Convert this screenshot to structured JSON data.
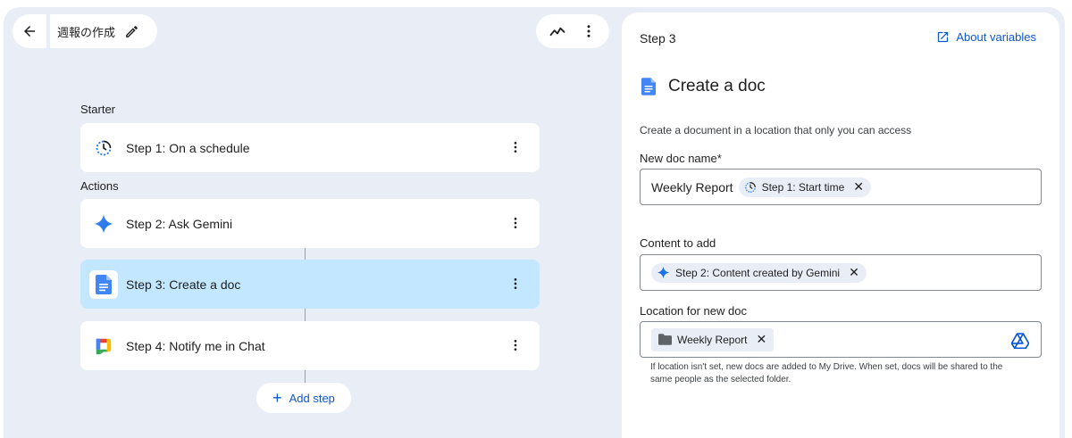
{
  "header": {
    "title": "週報の作成"
  },
  "flow": {
    "starter_label": "Starter",
    "actions_label": "Actions",
    "steps": [
      {
        "prefix": "Step 1:",
        "name": "On a schedule",
        "icon": "schedule-icon"
      },
      {
        "prefix": "Step 2:",
        "name": "Ask Gemini",
        "icon": "gemini-sparkle-icon"
      },
      {
        "prefix": "Step 3:",
        "name": "Create a doc",
        "icon": "google-docs-icon",
        "selected": true
      },
      {
        "prefix": "Step 4:",
        "name": "Notify me in Chat",
        "icon": "google-chat-icon"
      }
    ],
    "add_step_label": "Add step"
  },
  "panel": {
    "step_label": "Step 3",
    "about_label": "About variables",
    "title": "Create a doc",
    "description": "Create a document in a location that only you can access",
    "doc_name": {
      "label": "New doc name*",
      "text": "Weekly Report",
      "chip": "Step 1: Start time"
    },
    "content": {
      "label": "Content to add",
      "chip": "Step 2: Content created by Gemini"
    },
    "location": {
      "label": "Location for new doc",
      "chip": "Weekly Report",
      "hint": "If location isn't set, new docs are added to My Drive. When set, docs will be shared to the same people as the selected folder."
    }
  },
  "colors": {
    "canvas": "#e9edf6",
    "accent": "#0b57d0",
    "selected_step": "#c2e7ff"
  }
}
